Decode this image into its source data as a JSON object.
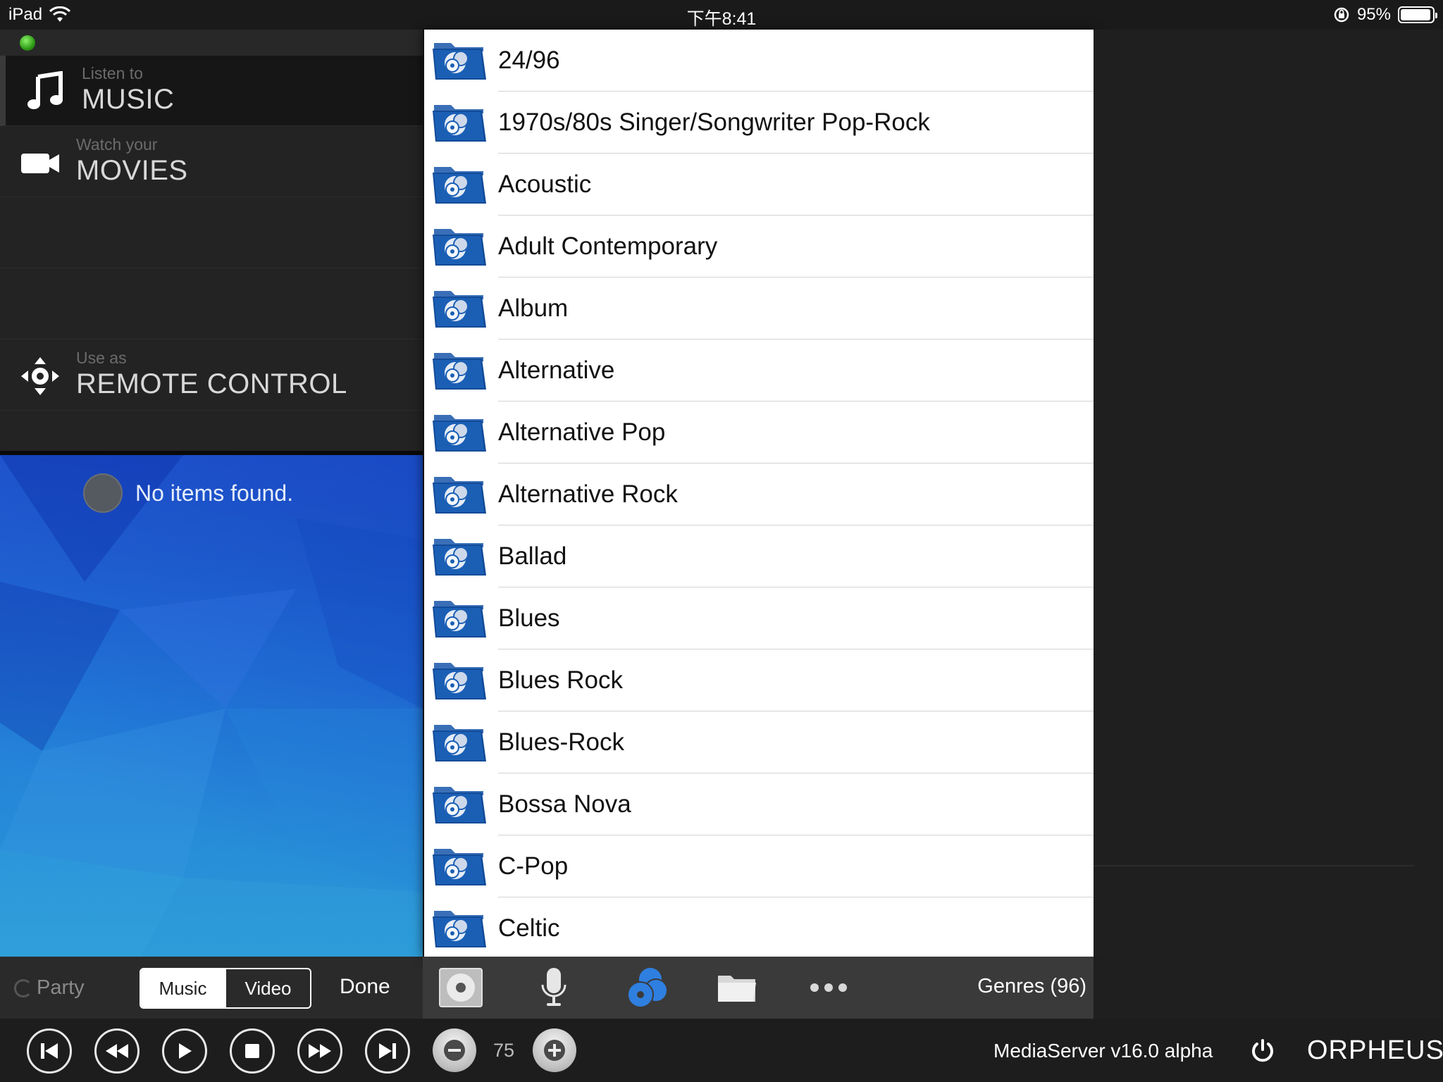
{
  "status_bar": {
    "device": "iPad",
    "time": "下午8:41",
    "battery": "95%",
    "battery_level": 0.95
  },
  "sidebar": {
    "items": [
      {
        "small": "Listen to",
        "big": "MUSIC",
        "icon": "music-note-icon",
        "active": true
      },
      {
        "small": "Watch your",
        "big": "MOVIES",
        "icon": "video-camera-icon",
        "active": false
      },
      {
        "small": "Use as",
        "big": "REMOTE CONTROL",
        "icon": "dpad-icon",
        "active": false
      }
    ],
    "no_items_text": "No items found."
  },
  "party_bar": {
    "party_label": "Party",
    "segments": [
      "Music",
      "Video"
    ],
    "selected_segment": "Music",
    "done_label": "Done"
  },
  "genre_list": {
    "items": [
      "24/96",
      "1970s/80s Singer/Songwriter Pop-Rock",
      "Acoustic",
      "Adult Contemporary",
      "Album",
      "Alternative",
      "Alternative Pop",
      "Alternative Rock",
      "Ballad",
      "Blues",
      "Blues Rock",
      "Blues-Rock",
      "Bossa Nova",
      "C-Pop",
      "Celtic"
    ],
    "item_icon": "genre-folder-icon"
  },
  "list_toolbar": {
    "tools": [
      "album-icon",
      "microphone-icon",
      "genres-icon",
      "folder-icon",
      "more-icon"
    ],
    "active_tool": "genres-icon",
    "count_label": "Genres (96)",
    "accent_color": "#2f7fe0"
  },
  "transport": {
    "volume": "75",
    "server_label": "MediaServer v16.0 alpha",
    "brand": "ORPHEUS"
  }
}
